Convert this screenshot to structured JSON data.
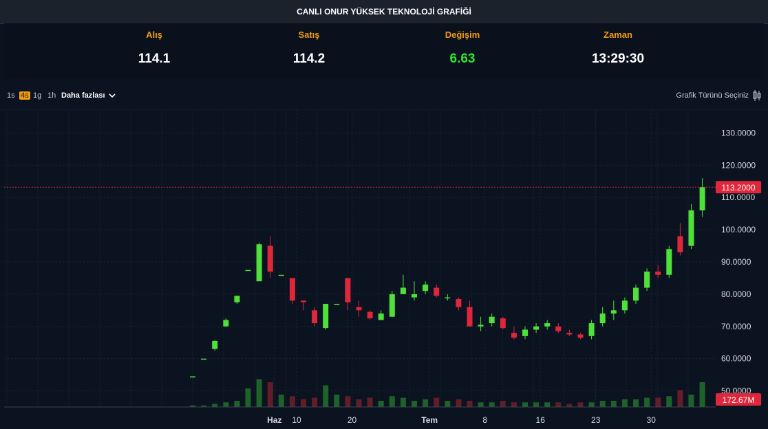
{
  "title": "CANLI ONUR YÜKSEK TEKNOLOJİ GRAFİĞİ",
  "stats": [
    {
      "label": "Alış",
      "value": "114.1",
      "color": "#ffffff"
    },
    {
      "label": "Satış",
      "value": "114.2",
      "color": "#ffffff"
    },
    {
      "label": "Değişim",
      "value": "6.63",
      "color": "#2ee52e"
    },
    {
      "label": "Zaman",
      "value": "13:29:30",
      "color": "#ffffff"
    }
  ],
  "toolbar": {
    "intervals": [
      "1s",
      "4s",
      "1g",
      "1h"
    ],
    "active_interval": "4s",
    "more_label": "Daha fazlası",
    "chart_type_label": "Grafik Türünü Seçiniz"
  },
  "colors": {
    "up": "#4fe03a",
    "down": "#e0263b",
    "volume_up": "#1f6b2a",
    "volume_down": "#6b1f2a",
    "accent": "#f39c12"
  },
  "chart_data": {
    "type": "candlestick",
    "title": "",
    "xlabel": "",
    "ylabel": "",
    "ylim": [
      45,
      135
    ],
    "y_ticks": [
      "130.0000",
      "120.0000",
      "110.0000",
      "100.0000",
      "90.0000",
      "80.0000",
      "70.0000",
      "60.0000",
      "50.0000"
    ],
    "x_tick_labels": [
      {
        "label": "Haz",
        "index": 8,
        "bold": true
      },
      {
        "label": "10",
        "index": 10,
        "bold": false
      },
      {
        "label": "20",
        "index": 15,
        "bold": false
      },
      {
        "label": "Tem",
        "index": 22,
        "bold": true
      },
      {
        "label": "8",
        "index": 27,
        "bold": false
      },
      {
        "label": "16",
        "index": 32,
        "bold": false
      },
      {
        "label": "23",
        "index": 37,
        "bold": false
      },
      {
        "label": "30",
        "index": 42,
        "bold": false
      }
    ],
    "last_price_label": "113.2000",
    "last_price": 113.2,
    "volume_label": "172.67M",
    "grid": true,
    "ohlc": [
      [
        54.5,
        54.5,
        54.5,
        54.5
      ],
      [
        60,
        60,
        60,
        60
      ],
      [
        63,
        65.8,
        62.5,
        65.5
      ],
      [
        70,
        72.5,
        70,
        72
      ],
      [
        77.5,
        79.5,
        77,
        79.5
      ],
      [
        87.5,
        87.5,
        87.5,
        87.5
      ],
      [
        84,
        96,
        85,
        95.5
      ],
      [
        95,
        98,
        85,
        87
      ],
      [
        86,
        86,
        86,
        86
      ],
      [
        85,
        85,
        77,
        78
      ],
      [
        78,
        78,
        75,
        77.5
      ],
      [
        75,
        76,
        70,
        71
      ],
      [
        69.5,
        77,
        69,
        77
      ],
      [
        77,
        77,
        77,
        77
      ],
      [
        85,
        85,
        75,
        77.5
      ],
      [
        76,
        78,
        73,
        75
      ],
      [
        74.5,
        75,
        72,
        72.5
      ],
      [
        72,
        75,
        72,
        74
      ],
      [
        73,
        81,
        73,
        80
      ],
      [
        80,
        86,
        80,
        82
      ],
      [
        79,
        84,
        78,
        80
      ],
      [
        81,
        84,
        80,
        83
      ],
      [
        82,
        83,
        79,
        79.5
      ],
      [
        79,
        80,
        78,
        79
      ],
      [
        78.5,
        79,
        75,
        76
      ],
      [
        76,
        78,
        70,
        70
      ],
      [
        70,
        73,
        68.5,
        70.5
      ],
      [
        71,
        74,
        70,
        73
      ],
      [
        72.5,
        73,
        69,
        69.5
      ],
      [
        68,
        70,
        66,
        66.5
      ],
      [
        67,
        70,
        66,
        69
      ],
      [
        69,
        71,
        68,
        70
      ],
      [
        70,
        72,
        69,
        71
      ],
      [
        70,
        71,
        68,
        68.5
      ],
      [
        68,
        69,
        67,
        67.5
      ],
      [
        67.5,
        68,
        66,
        66.5
      ],
      [
        67,
        72,
        66,
        71
      ],
      [
        71,
        76,
        70,
        74
      ],
      [
        74,
        78,
        72,
        75
      ],
      [
        75,
        79,
        74,
        78
      ],
      [
        78,
        83,
        77,
        82
      ],
      [
        82,
        88,
        81,
        87
      ],
      [
        87,
        89,
        85,
        86
      ],
      [
        86,
        95,
        85,
        94
      ],
      [
        98,
        102,
        92,
        93
      ],
      [
        95,
        108,
        94,
        106
      ],
      [
        106,
        116,
        104,
        113.2
      ]
    ],
    "volume": [
      0.05,
      0.05,
      0.1,
      0.15,
      0.2,
      0.6,
      0.9,
      0.8,
      0.4,
      0.35,
      0.25,
      0.3,
      0.7,
      0.4,
      0.35,
      0.25,
      0.3,
      0.2,
      0.35,
      0.3,
      0.2,
      0.25,
      0.3,
      0.2,
      0.25,
      0.2,
      0.15,
      0.15,
      0.2,
      0.15,
      0.15,
      0.15,
      0.15,
      0.15,
      0.1,
      0.15,
      0.15,
      0.2,
      0.2,
      0.25,
      0.25,
      0.3,
      0.3,
      0.35,
      0.55,
      0.4,
      0.8
    ]
  }
}
